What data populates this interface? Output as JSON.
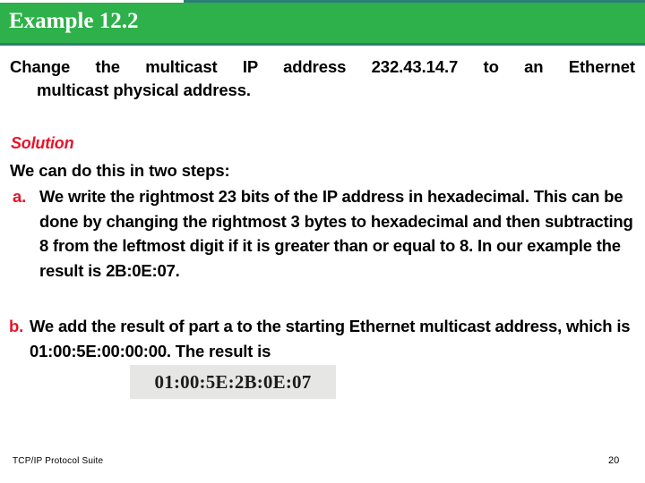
{
  "slide": {
    "header": {
      "title": "Example 12.2",
      "bar_color": "#2eb04a",
      "rule_color": "#2b7f76",
      "title_color": "#ffffff"
    },
    "intro": {
      "line1": "Change the multicast IP address 232.43.14.7 to an Ethernet",
      "line2": "multicast physical address."
    },
    "solution": {
      "heading": "Solution",
      "heading_color": "#e8142a",
      "steps_intro": "We can do this in two steps:",
      "items": [
        {
          "marker": "a.",
          "marker_color": "#e8142a",
          "text": "We write the rightmost 23 bits of the IP address in hexadecimal. This can be done by changing the rightmost 3 bytes to hexadecimal and then subtracting 8 from the leftmost digit if it is greater than or equal to 8. In our example the result is 2B:0E:07."
        },
        {
          "marker": "b.",
          "marker_color": "#e8142a",
          "text": "We add the result of part a to the starting Ethernet multicast address, which is 01:00:5E:00:00:00. The result is"
        }
      ]
    },
    "result": {
      "value": "01:00:5E:2B:0E:07",
      "background": "#e6e6e4"
    },
    "footer": {
      "left": "TCP/IP Protocol Suite",
      "page_number": "20"
    }
  }
}
